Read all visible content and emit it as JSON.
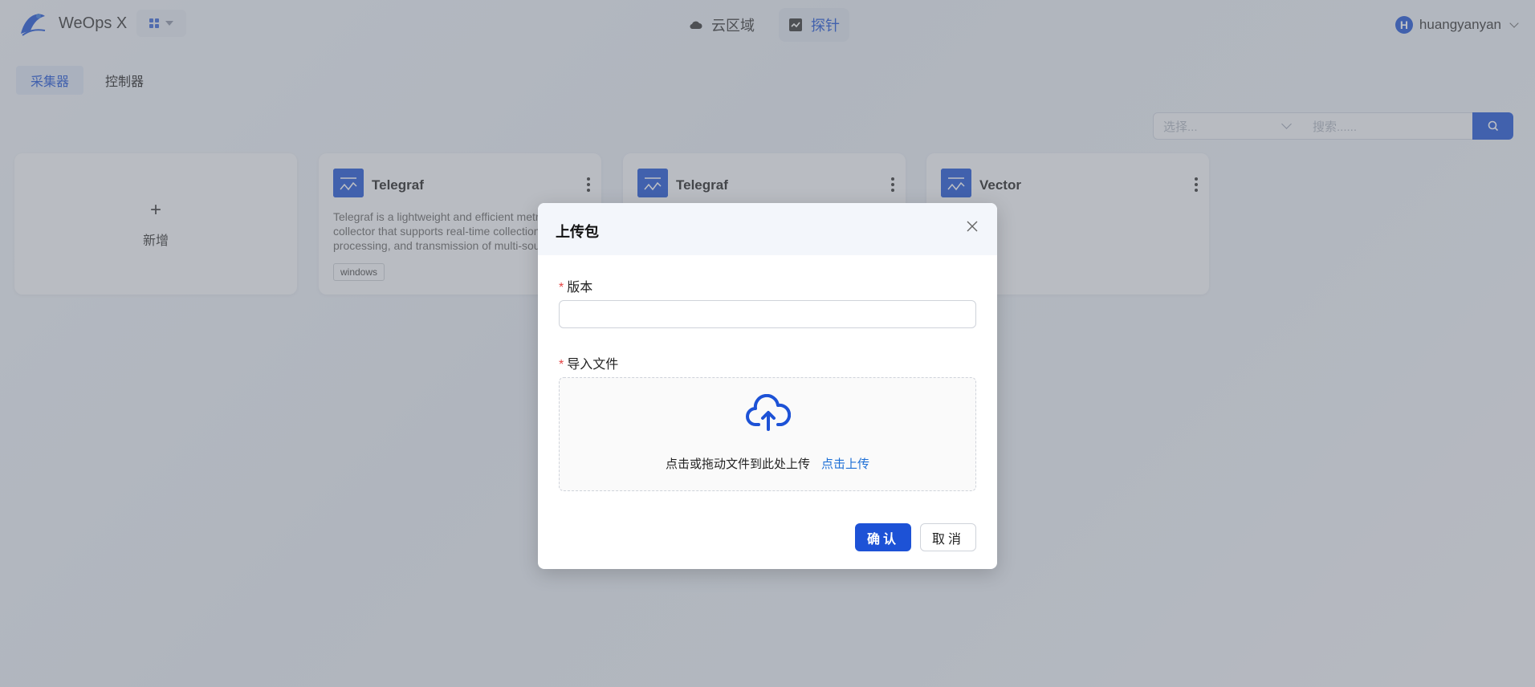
{
  "header": {
    "app_title": "WeOps X",
    "nav": [
      {
        "label": "云区域",
        "icon": "cloud-icon"
      },
      {
        "label": "探针",
        "icon": "probe-icon"
      }
    ],
    "user": {
      "avatar_letter": "H",
      "name": "huangyanyan"
    }
  },
  "subtabs": [
    {
      "label": "采集器",
      "active": true
    },
    {
      "label": "控制器",
      "active": false
    }
  ],
  "filter": {
    "select_placeholder": "选择...",
    "search_placeholder": "搜索......"
  },
  "cards": {
    "add_label": "新增",
    "add_plus": "+",
    "items": [
      {
        "name": "Telegraf",
        "description": "Telegraf is a lightweight and efficient metrics collector that supports real-time collection, processing, and transmission of multi-source data.",
        "tag": "windows"
      },
      {
        "name": "Telegraf"
      },
      {
        "name": "Vector"
      }
    ]
  },
  "modal": {
    "title": "上传包",
    "version_label": "版本",
    "file_label": "导入文件",
    "required_mark": "*",
    "drop_text": "点击或拖动文件到此处上传",
    "drop_link": "点击上传",
    "ok_label": "确认",
    "cancel_label": "取消"
  },
  "colors": {
    "primary": "#1d52d6",
    "required": "#e54545",
    "link": "#1d6fd6"
  }
}
